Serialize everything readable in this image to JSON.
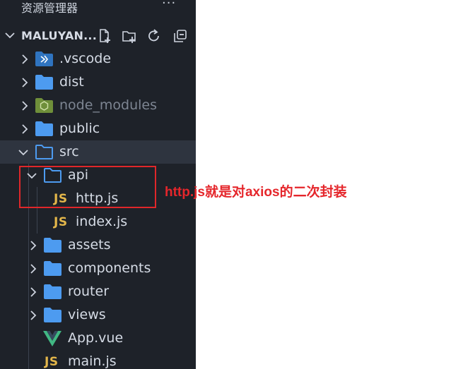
{
  "explorer": {
    "title": "资源管理器",
    "more_label": "···",
    "workspace": {
      "name": "MALUYAN..."
    },
    "tree": {
      "vscode": ".vscode",
      "dist": "dist",
      "node_modules": "node_modules",
      "public": "public",
      "src": "src",
      "api": "api",
      "http_js": "http.js",
      "index_js": "index.js",
      "assets": "assets",
      "components": "components",
      "router": "router",
      "views": "views",
      "app_vue": "App.vue",
      "main_js": "main.js"
    },
    "js_badge": "JS"
  },
  "annotation": {
    "text": "http.js就是对axios的二次封装",
    "color": "#e5262b"
  },
  "colors": {
    "sidebar_bg": "#1e2229",
    "folder_blue": "#4d9bf0",
    "js_yellow": "#e3b64a",
    "vue_green": "#41b883",
    "highlight_red": "#e0272a"
  }
}
